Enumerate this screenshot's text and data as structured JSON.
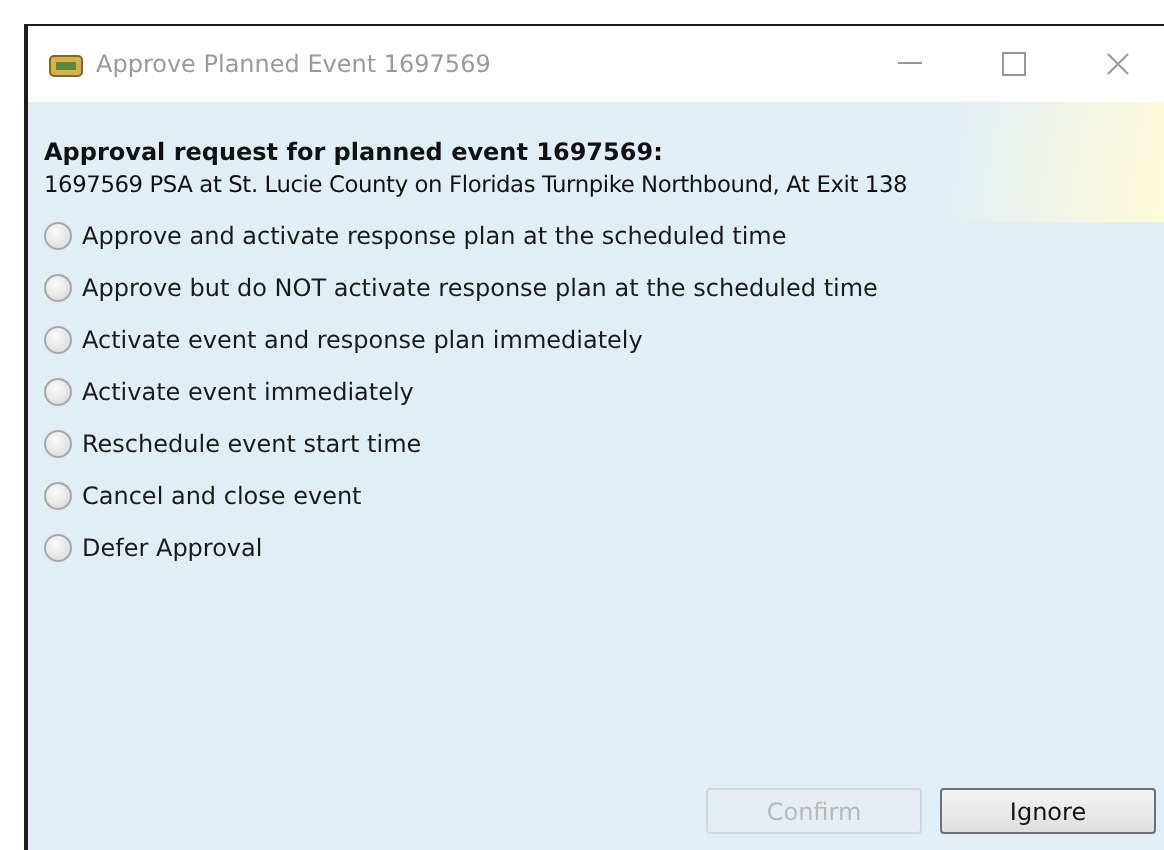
{
  "window": {
    "title": "Approve Planned Event 1697569"
  },
  "heading": "Approval request for planned event 1697569:",
  "description": "1697569 PSA at St. Lucie County on Floridas Turnpike Northbound, At Exit 138",
  "options": [
    {
      "label": "Approve and activate response plan at the scheduled time",
      "selected": false
    },
    {
      "label": "Approve but do NOT activate response plan at the scheduled time",
      "selected": false
    },
    {
      "label": "Activate event and response plan immediately",
      "selected": false
    },
    {
      "label": "Activate event immediately",
      "selected": false
    },
    {
      "label": "Reschedule event start time",
      "selected": false
    },
    {
      "label": "Cancel and close event",
      "selected": false
    },
    {
      "label": "Defer Approval",
      "selected": false
    }
  ],
  "buttons": [
    {
      "label": "Confirm",
      "disabled": true
    },
    {
      "label": "Ignore",
      "disabled": false
    }
  ]
}
